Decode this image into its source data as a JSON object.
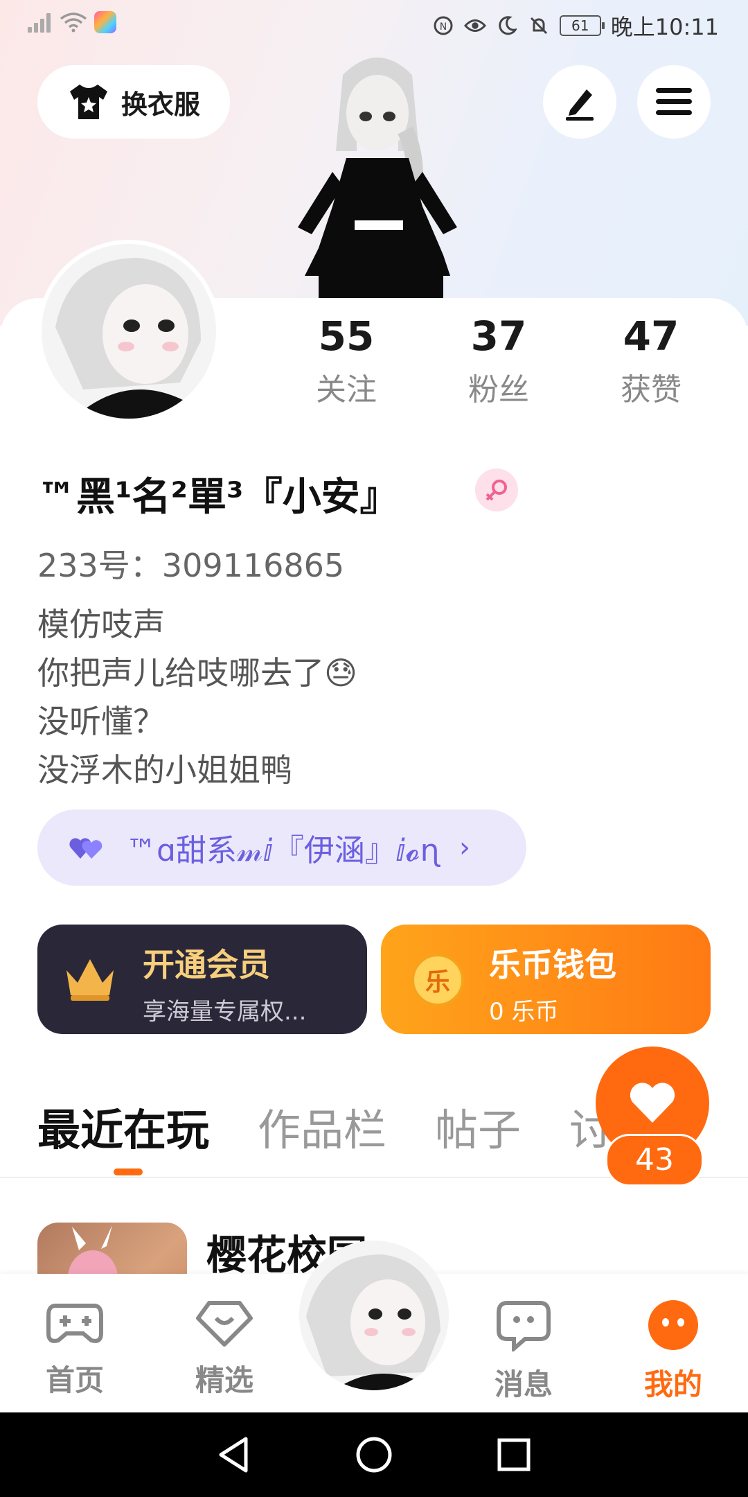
{
  "status_bar": {
    "time": "晚上10:11",
    "battery": "61"
  },
  "header": {
    "outfit_button_label": "换衣服"
  },
  "profile": {
    "stats": [
      {
        "value": "55",
        "label": "关注"
      },
      {
        "value": "37",
        "label": "粉丝"
      },
      {
        "value": "47",
        "label": "获赞"
      }
    ],
    "nickname": "™黑¹名²單³『小安』",
    "uid": "233号：309116865",
    "bio_lines": [
      "模仿吱声",
      "你把声儿给吱哪去了😓",
      "没听懂？",
      "没浮木的小姐姐鸭"
    ],
    "cp_pill_text": "™ɑ甜系𝓂ⅈ『伊涵』ⅈ𝓸ɳ"
  },
  "cards": {
    "vip_title": "开通会员",
    "vip_sub": "享海量专属权...",
    "wallet_title": "乐币钱包",
    "wallet_sub": "0 乐币",
    "coin_char": "乐"
  },
  "tabs": [
    "最近在玩",
    "作品栏",
    "帖子",
    "讨"
  ],
  "floating_like_count": "43",
  "recent_game": {
    "title": "樱花校园"
  },
  "bottom_nav": [
    {
      "label": "首页"
    },
    {
      "label": "精选"
    },
    {
      "label": "消息"
    },
    {
      "label": "我的"
    }
  ],
  "colors": {
    "accent": "#ff6a10",
    "vip_bg": "#2a2838",
    "vip_gold": "#f7cf7d",
    "pill_bg": "#ebe8fb",
    "pill_text": "#6b5fe0"
  }
}
